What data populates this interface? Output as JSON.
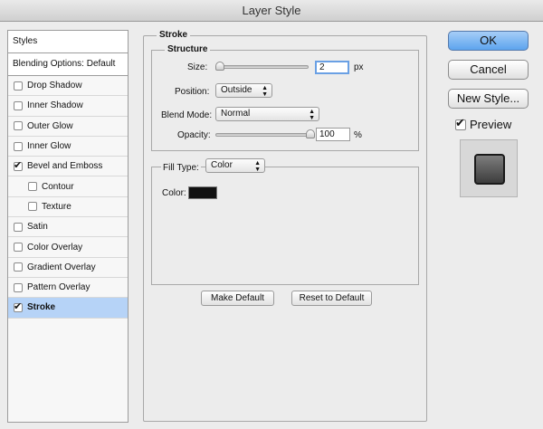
{
  "window": {
    "title": "Layer Style"
  },
  "styles_panel": {
    "header": "Styles",
    "blending": "Blending Options: Default",
    "items": [
      {
        "label": "Drop Shadow",
        "checked": false,
        "sub": false,
        "selected": false
      },
      {
        "label": "Inner Shadow",
        "checked": false,
        "sub": false,
        "selected": false
      },
      {
        "label": "Outer Glow",
        "checked": false,
        "sub": false,
        "selected": false
      },
      {
        "label": "Inner Glow",
        "checked": false,
        "sub": false,
        "selected": false
      },
      {
        "label": "Bevel and Emboss",
        "checked": true,
        "sub": false,
        "selected": false
      },
      {
        "label": "Contour",
        "checked": false,
        "sub": true,
        "selected": false
      },
      {
        "label": "Texture",
        "checked": false,
        "sub": true,
        "selected": false
      },
      {
        "label": "Satin",
        "checked": false,
        "sub": false,
        "selected": false
      },
      {
        "label": "Color Overlay",
        "checked": false,
        "sub": false,
        "selected": false
      },
      {
        "label": "Gradient Overlay",
        "checked": false,
        "sub": false,
        "selected": false
      },
      {
        "label": "Pattern Overlay",
        "checked": false,
        "sub": false,
        "selected": false
      },
      {
        "label": "Stroke",
        "checked": true,
        "sub": false,
        "selected": true
      }
    ]
  },
  "stroke": {
    "group_title": "Stroke",
    "structure_title": "Structure",
    "size_label": "Size:",
    "size_value": "2",
    "size_unit": "px",
    "size_fraction": 0.02,
    "position_label": "Position:",
    "position_value": "Outside",
    "blend_label": "Blend Mode:",
    "blend_value": "Normal",
    "opacity_label": "Opacity:",
    "opacity_value": "100",
    "opacity_unit": "%",
    "opacity_fraction": 1.0,
    "fill_type_label": "Fill Type:",
    "fill_type_value": "Color",
    "color_label": "Color:",
    "color_value": "#111111",
    "make_default": "Make Default",
    "reset_default": "Reset to Default"
  },
  "buttons": {
    "ok": "OK",
    "cancel": "Cancel",
    "new_style": "New Style..."
  },
  "preview": {
    "label": "Preview",
    "checked": true
  }
}
